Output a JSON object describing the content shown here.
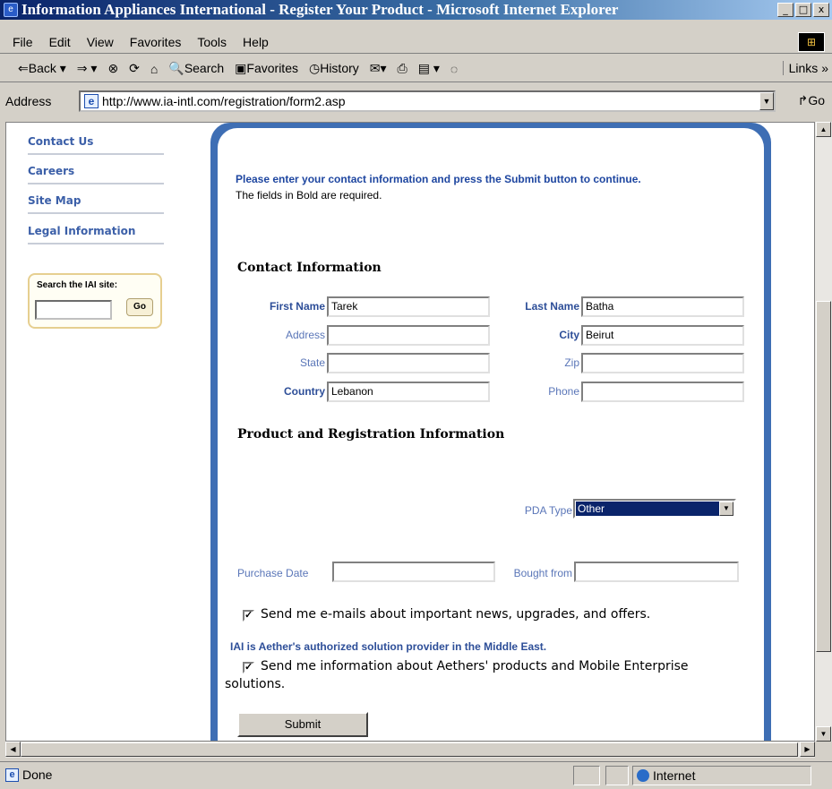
{
  "window": {
    "title": "Information Appliances International - Register Your Product - Microsoft Internet Explorer",
    "controls": [
      "_",
      "□",
      "x"
    ]
  },
  "menu": [
    "File",
    "Edit",
    "View",
    "Favorites",
    "Tools",
    "Help"
  ],
  "toolbar": {
    "back": "Back",
    "search": "Search",
    "favorites": "Favorites",
    "history": "History",
    "links": "Links"
  },
  "address": {
    "label": "Address",
    "url": "http://www.ia-intl.com/registration/form2.asp",
    "go": "Go"
  },
  "sidebar": {
    "links": [
      "Contact Us",
      "Careers",
      "Site Map",
      "Legal Information"
    ],
    "search": {
      "label": "Search the IAI site:",
      "button": "Go",
      "value": ""
    }
  },
  "form": {
    "intro_bold": "Please enter your contact information and press the Submit button to continue.",
    "intro": "The fields in Bold are required.",
    "contact_title": "Contact Information",
    "fields": {
      "first_name": {
        "label": "First Name",
        "value": "Tarek"
      },
      "last_name": {
        "label": "Last Name",
        "value": "Batha"
      },
      "address": {
        "label": "Address",
        "value": ""
      },
      "city": {
        "label": "City",
        "value": "Beirut"
      },
      "state": {
        "label": "State",
        "value": ""
      },
      "zip": {
        "label": "Zip",
        "value": ""
      },
      "country": {
        "label": "Country",
        "value": "Lebanon"
      },
      "phone": {
        "label": "Phone",
        "value": ""
      }
    },
    "product_title": "Product and Registration Information",
    "pda_type": {
      "label": "PDA Type",
      "value": "Other"
    },
    "purchase_date": {
      "label": "Purchase Date",
      "value": ""
    },
    "bought_from": {
      "label": "Bought from",
      "value": ""
    },
    "email_opt": {
      "label": "Send me e-mails about important news, upgrades, and offers.",
      "checked": true
    },
    "provider_note": "IAI is Aether's authorized solution provider in the Middle East.",
    "aether_opt": {
      "label_line1": "Send me information about Aethers' products and Mobile Enterprise",
      "label_line2": "solutions.",
      "checked": true
    },
    "submit": "Submit"
  },
  "status": {
    "text": "Done",
    "zone": "Internet"
  },
  "colors": {
    "frame_blue": "#3e6eb4",
    "link_blue": "#3b5fa8",
    "title_bar": "#0a246a"
  }
}
